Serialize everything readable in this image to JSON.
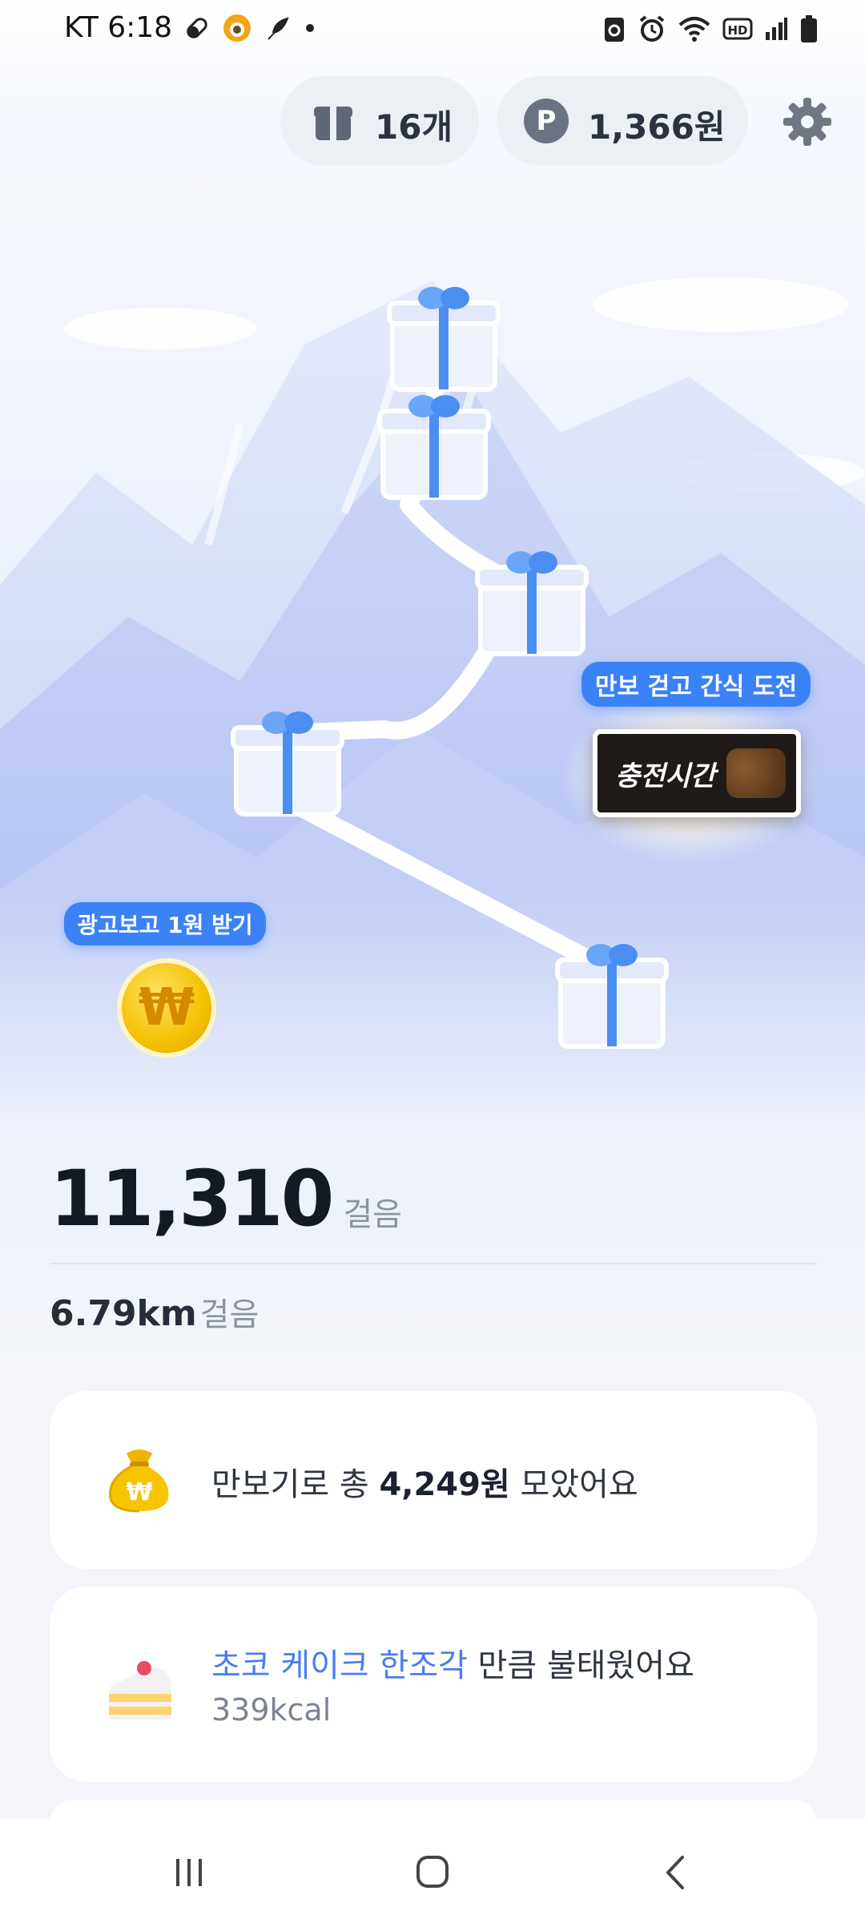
{
  "status_bar": {
    "carrier_time": "KT 6:18",
    "left_icons": [
      "pill-icon",
      "emoji-badge-icon",
      "feather-icon",
      "dot-icon"
    ],
    "right_icons": [
      "recycle-icon",
      "alarm-icon",
      "wifi-icon",
      "hd-icon",
      "signal-icon",
      "battery-icon"
    ]
  },
  "header": {
    "gift_count": "16개",
    "points": "1,366원",
    "points_badge": "P"
  },
  "scene": {
    "gift_boxes": 5,
    "ad_bubble": "광고보고 1원 받기",
    "coin_symbol": "₩",
    "snack_bubble": "만보 걷고 간식 도전",
    "snack_label": "충전시간"
  },
  "steps": {
    "count": "11,310",
    "unit": "걸음"
  },
  "distance": {
    "value": "6.79km",
    "unit": "걸음"
  },
  "cards": {
    "savings": {
      "prefix": "만보기로 총 ",
      "amount": "4,249원",
      "suffix": " 모았어요",
      "bag_symbol": "₩"
    },
    "calories": {
      "highlight": "초코 케이크 한조각",
      "suffix": " 만큼 불태웠어요",
      "kcal": "339kcal"
    }
  },
  "colors": {
    "accent": "#3b82f6",
    "highlight_text": "#4a7cf0",
    "gift_box": "#eef2fc",
    "ribbon": "#4b8ef2",
    "coin": "#f7c400",
    "background": "#eef2fb"
  }
}
